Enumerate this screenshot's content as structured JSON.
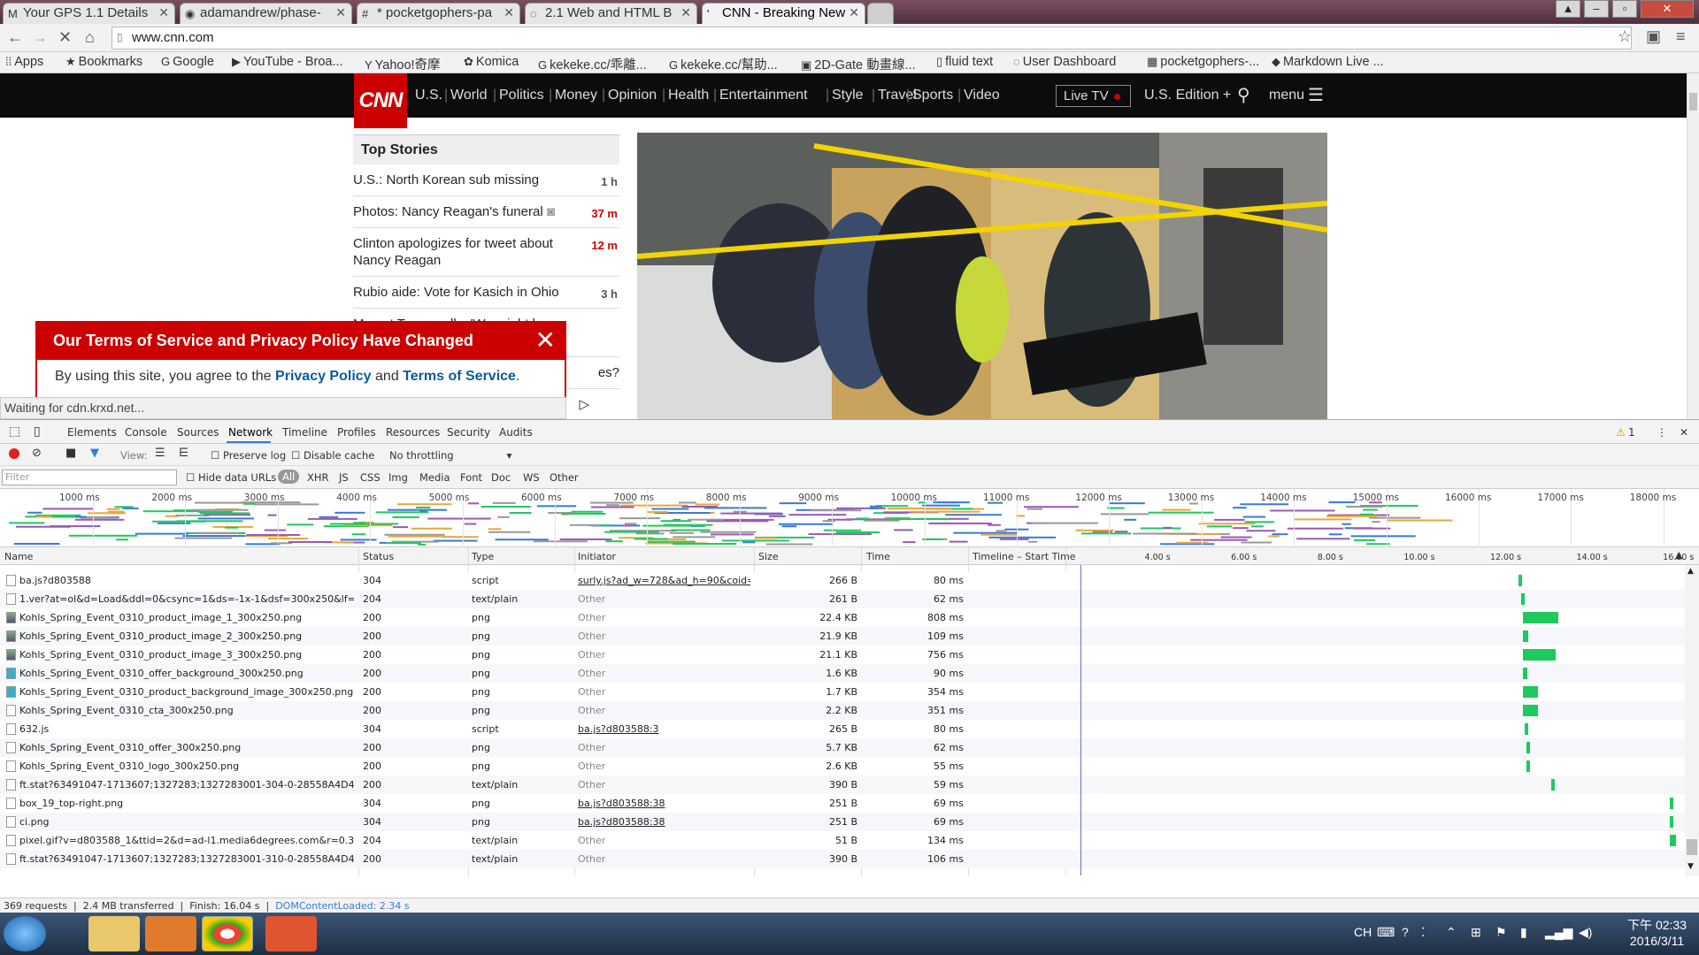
{
  "browser": {
    "tabs": [
      {
        "label": "Your GPS 1.1 Details",
        "icon": "gmail-icon",
        "glyph": "M"
      },
      {
        "label": "adamandrew/phase-",
        "icon": "github-icon",
        "glyph": "◉"
      },
      {
        "label": "* pocketgophers-pa",
        "icon": "page-icon",
        "glyph": "#"
      },
      {
        "label": "2.1 Web and HTML B",
        "icon": "page-icon",
        "glyph": "◌"
      },
      {
        "label": "CNN - Breaking New",
        "icon": "cnn-icon",
        "glyph": "'",
        "active": true
      }
    ],
    "url": "www.cnn.com",
    "bookmarks": [
      {
        "label": "Apps",
        "glyph": "⁞⁞"
      },
      {
        "label": "Bookmarks",
        "glyph": "★"
      },
      {
        "label": "Google",
        "glyph": "G"
      },
      {
        "label": "YouTube - Broa...",
        "glyph": "▶"
      },
      {
        "label": "Yahoo!奇摩",
        "glyph": "Y"
      },
      {
        "label": "Komica",
        "glyph": "✿"
      },
      {
        "label": "kekeke.cc/乖離...",
        "glyph": "G"
      },
      {
        "label": "kekeke.cc/幫助...",
        "glyph": "G"
      },
      {
        "label": "2D-Gate 動畫線...",
        "glyph": "▣"
      },
      {
        "label": "fluid text",
        "glyph": "▯"
      },
      {
        "label": "User Dashboard",
        "glyph": "◌"
      },
      {
        "label": "pocketgophers-...",
        "glyph": "▦"
      },
      {
        "label": "Markdown Live ...",
        "glyph": "◆"
      }
    ]
  },
  "cnn": {
    "logo": "CNN",
    "nav": [
      "U.S.",
      "World",
      "Politics",
      "Money",
      "Opinion",
      "Health",
      "Entertainment",
      "Style",
      "Travel",
      "Sports",
      "Video"
    ],
    "live_tv": "Live TV",
    "edition": "U.S. Edition +",
    "menu": "menu",
    "top_stories_title": "Top Stories",
    "stories": [
      {
        "title": "U.S.: North Korean sub missing",
        "age": "1 h",
        "red": false
      },
      {
        "title": "Photos: Nancy Reagan's funeral",
        "age": "37 m",
        "red": true,
        "camera": true
      },
      {
        "title": "Clinton apologizes for tweet about Nancy Reagan",
        "age": "12 m",
        "red": true
      },
      {
        "title": "Rubio aide: Vote for Kasich in Ohio",
        "age": "3 h",
        "red": false
      },
      {
        "title": "Man at Trump rally: 'We might have to kill'",
        "age": "",
        "red": false
      }
    ],
    "partial_story": "es?",
    "tos": {
      "title": "Our Terms of Service and Privacy Policy Have Changed",
      "body_prefix": "By using this site, you agree to the",
      "privacy": "Privacy Policy",
      "and": "and",
      "terms": "Terms of Service",
      "suffix": "."
    },
    "status": "Waiting for cdn.krxd.net..."
  },
  "devtools": {
    "tabs": [
      "Elements",
      "Console",
      "Sources",
      "Network",
      "Timeline",
      "Profiles",
      "Resources",
      "Security",
      "Audits"
    ],
    "active_tab": "Network",
    "warnings": "1",
    "toolbar": {
      "view": "View:",
      "preserve_log": "Preserve log",
      "disable_cache": "Disable cache",
      "throttling": "No throttling"
    },
    "filter": {
      "placeholder": "Filter",
      "hide_data_urls": "Hide data URLs",
      "types": [
        "All",
        "XHR",
        "JS",
        "CSS",
        "Img",
        "Media",
        "Font",
        "Doc",
        "WS",
        "Other"
      ]
    },
    "overview_ticks": [
      "1000 ms",
      "2000 ms",
      "3000 ms",
      "4000 ms",
      "5000 ms",
      "6000 ms",
      "7000 ms",
      "8000 ms",
      "9000 ms",
      "10000 ms",
      "11000 ms",
      "12000 ms",
      "13000 ms",
      "14000 ms",
      "15000 ms",
      "16000 ms",
      "17000 ms",
      "18000 ms"
    ],
    "columns": [
      "Name",
      "Status",
      "Type",
      "Initiator",
      "Size",
      "Time",
      "Timeline – Start Time"
    ],
    "waterfall_ticks": [
      "4.00 s",
      "6.00 s",
      "8.00 s",
      "10.00 s",
      "12.00 s",
      "14.00 s",
      "16.00 s"
    ],
    "requests": [
      {
        "name": "ba.js?d803588",
        "status": "304",
        "type": "script",
        "initiator": "surly.js?ad_w=728&ad_h=90&coid=111;...",
        "link": true,
        "size": "266 B",
        "time": "80 ms",
        "start": 12.05,
        "dur": 0.08,
        "icon": "plain"
      },
      {
        "name": "1.ver?at=ol&d=Load&ddl=0&csync=1&ds=-1x-1&dsf=300x250&lf=1&mbi...",
        "status": "204",
        "type": "text/plain",
        "initiator": "Other",
        "link": false,
        "size": "261 B",
        "time": "62 ms",
        "start": 12.1,
        "dur": 0.06,
        "icon": "plain"
      },
      {
        "name": "Kohls_Spring_Event_0310_product_image_1_300x250.png",
        "status": "200",
        "type": "png",
        "initiator": "Other",
        "link": false,
        "size": "22.4 KB",
        "time": "808 ms",
        "start": 12.15,
        "dur": 0.81,
        "icon": "img"
      },
      {
        "name": "Kohls_Spring_Event_0310_product_image_2_300x250.png",
        "status": "200",
        "type": "png",
        "initiator": "Other",
        "link": false,
        "size": "21.9 KB",
        "time": "109 ms",
        "start": 12.15,
        "dur": 0.11,
        "icon": "img"
      },
      {
        "name": "Kohls_Spring_Event_0310_product_image_3_300x250.png",
        "status": "200",
        "type": "png",
        "initiator": "Other",
        "link": false,
        "size": "21.1 KB",
        "time": "756 ms",
        "start": 12.15,
        "dur": 0.76,
        "icon": "img"
      },
      {
        "name": "Kohls_Spring_Event_0310_offer_background_300x250.png",
        "status": "200",
        "type": "png",
        "initiator": "Other",
        "link": false,
        "size": "1.6 KB",
        "time": "90 ms",
        "start": 12.15,
        "dur": 0.09,
        "icon": "cyan"
      },
      {
        "name": "Kohls_Spring_Event_0310_product_background_image_300x250.png",
        "status": "200",
        "type": "png",
        "initiator": "Other",
        "link": false,
        "size": "1.7 KB",
        "time": "354 ms",
        "start": 12.15,
        "dur": 0.35,
        "icon": "cyan"
      },
      {
        "name": "Kohls_Spring_Event_0310_cta_300x250.png",
        "status": "200",
        "type": "png",
        "initiator": "Other",
        "link": false,
        "size": "2.2 KB",
        "time": "351 ms",
        "start": 12.15,
        "dur": 0.35,
        "icon": "plain"
      },
      {
        "name": "632.js",
        "status": "304",
        "type": "script",
        "initiator": "ba.js?d803588:3",
        "link": true,
        "size": "265 B",
        "time": "80 ms",
        "start": 12.18,
        "dur": 0.08,
        "icon": "plain"
      },
      {
        "name": "Kohls_Spring_Event_0310_offer_300x250.png",
        "status": "200",
        "type": "png",
        "initiator": "Other",
        "link": false,
        "size": "5.7 KB",
        "time": "62 ms",
        "start": 12.22,
        "dur": 0.06,
        "icon": "plain"
      },
      {
        "name": "Kohls_Spring_Event_0310_logo_300x250.png",
        "status": "200",
        "type": "png",
        "initiator": "Other",
        "link": false,
        "size": "2.6 KB",
        "time": "55 ms",
        "start": 12.22,
        "dur": 0.055,
        "icon": "plain"
      },
      {
        "name": "ft.stat?63491047-1713607;1327283;1327283001-304-0-28558A4D4B676F-3...",
        "status": "200",
        "type": "text/plain",
        "initiator": "Other",
        "link": false,
        "size": "390 B",
        "time": "59 ms",
        "start": 12.8,
        "dur": 0.06,
        "icon": "plain"
      },
      {
        "name": "box_19_top-right.png",
        "status": "304",
        "type": "png",
        "initiator": "ba.js?d803588:38",
        "link": true,
        "size": "251 B",
        "time": "69 ms",
        "start": 15.55,
        "dur": 0.07,
        "icon": "plain"
      },
      {
        "name": "ci.png",
        "status": "304",
        "type": "png",
        "initiator": "ba.js?d803588:38",
        "link": true,
        "size": "251 B",
        "time": "69 ms",
        "start": 15.55,
        "dur": 0.07,
        "icon": "plain"
      },
      {
        "name": "pixel.gif?v=d803588_1&ttid=2&d=ad-l1.media6degrees.com&r=0.3083814...",
        "status": "204",
        "type": "text/plain",
        "initiator": "Other",
        "link": false,
        "size": "51 B",
        "time": "134 ms",
        "start": 15.55,
        "dur": 0.13,
        "icon": "plain"
      },
      {
        "name": "ft.stat?63491047-1713607;1327283;1327283001-310-0-28558A4D4B676F-8...",
        "status": "200",
        "type": "text/plain",
        "initiator": "Other",
        "link": false,
        "size": "390 B",
        "time": "106 ms",
        "start": 16.4,
        "dur": 0.1,
        "icon": "plain"
      }
    ],
    "summary": {
      "requests": "369 requests",
      "transferred": "2.4 MB transferred",
      "finish": "Finish: 16.04 s",
      "dcl": "DOMContentLoaded: 2.34 s"
    }
  },
  "taskbar": {
    "lang": "CH",
    "time": "下午 02:33",
    "date": "2016/3/11"
  }
}
